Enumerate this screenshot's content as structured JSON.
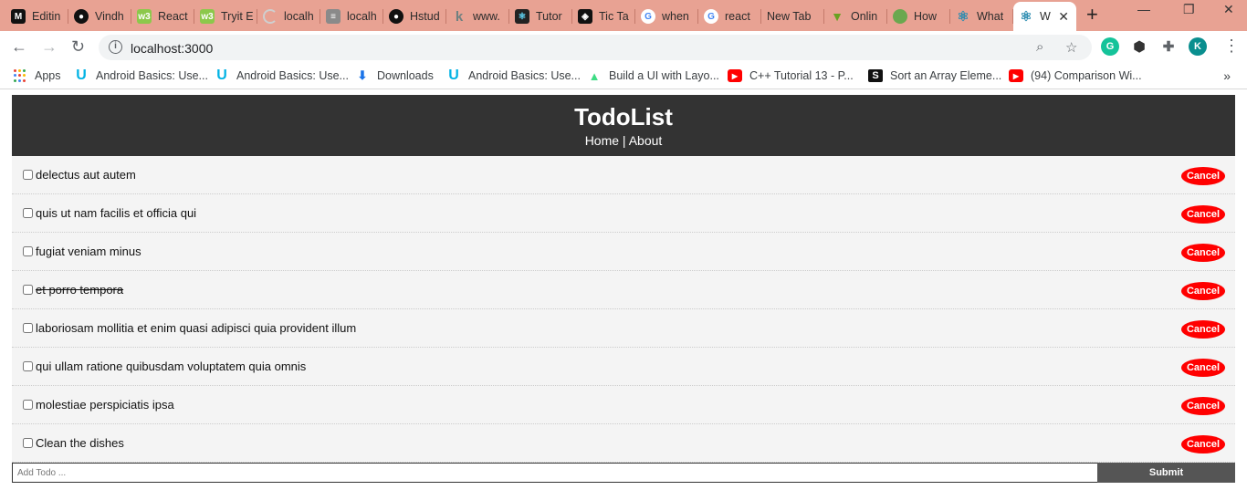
{
  "browser": {
    "tabs": [
      {
        "label": "Editin",
        "icon": "medium-icon",
        "color": "#111111"
      },
      {
        "label": "Vindh",
        "icon": "github-icon",
        "color": "#111111"
      },
      {
        "label": "React",
        "icon": "w3schools-icon",
        "color": "#8cc84b"
      },
      {
        "label": "Tryit E",
        "icon": "w3schools-icon",
        "color": "#8cc84b"
      },
      {
        "label": "localh",
        "icon": "loading-icon",
        "color": "#cfcfcf"
      },
      {
        "label": "localh",
        "icon": "document-icon",
        "color": "#8a8a8a"
      },
      {
        "label": "Hstud",
        "icon": "github-icon",
        "color": "#111111"
      },
      {
        "label": "www.",
        "icon": "k-icon",
        "color": "#7a8b8b"
      },
      {
        "label": "Tutor",
        "icon": "react-icon",
        "color": "#222222"
      },
      {
        "label": "Tic Ta",
        "icon": "codesandbox-icon",
        "color": "#111111"
      },
      {
        "label": "when",
        "icon": "google-icon",
        "color": "#ffffff"
      },
      {
        "label": "react",
        "icon": "google-icon",
        "color": "#ffffff"
      },
      {
        "label": "New Tab",
        "icon": "",
        "color": ""
      },
      {
        "label": "Onlin",
        "icon": "download-icon",
        "color": "#6aa121"
      },
      {
        "label": "How",
        "icon": "circle-icon",
        "color": "#6aa84f"
      },
      {
        "label": "What",
        "icon": "react-icon",
        "color": "#61dafb"
      },
      {
        "label": "W",
        "icon": "react-icon",
        "color": "#61dafb"
      }
    ],
    "new_tab": "+",
    "address": "localhost:3000",
    "avatar_letter": "K",
    "bookmarks": [
      {
        "label": "Apps"
      },
      {
        "label": "Android Basics: Use..."
      },
      {
        "label": "Android Basics: Use..."
      },
      {
        "label": "Downloads"
      },
      {
        "label": "Android Basics: Use..."
      },
      {
        "label": "Build a UI with Layo..."
      },
      {
        "label": "C++ Tutorial 13 - P..."
      },
      {
        "label": "Sort an Array Eleme..."
      },
      {
        "label": "(94) Comparison Wi..."
      }
    ]
  },
  "app": {
    "title": "TodoList",
    "nav_home": "Home",
    "nav_sep": " | ",
    "nav_about": "About",
    "todos": [
      {
        "title": "delectus aut autem",
        "completed": false
      },
      {
        "title": "quis ut nam facilis et officia qui",
        "completed": false
      },
      {
        "title": "fugiat veniam minus",
        "completed": false
      },
      {
        "title": "et porro tempora",
        "completed": true
      },
      {
        "title": "laboriosam mollitia et enim quasi adipisci quia provident illum",
        "completed": false
      },
      {
        "title": "qui ullam ratione quibusdam voluptatem quia omnis",
        "completed": false
      },
      {
        "title": "molestiae perspiciatis ipsa",
        "completed": false
      },
      {
        "title": "Clean the dishes",
        "completed": false
      }
    ],
    "cancel_label": "Cancel",
    "add_placeholder": "Add Todo ...",
    "submit_label": "Submit",
    "colors": {
      "header": "#333333",
      "cancel": "#ff0000",
      "submit": "#555555",
      "list_bg": "#f4f4f4"
    }
  }
}
